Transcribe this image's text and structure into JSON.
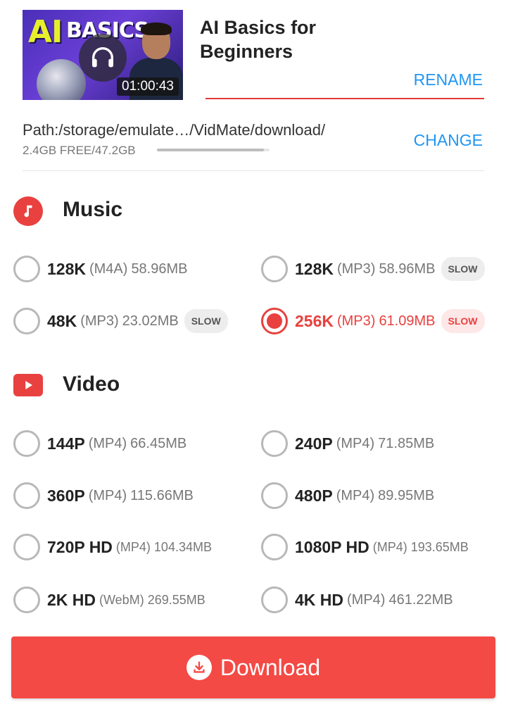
{
  "header": {
    "title": "AI Basics for Beginners",
    "thumbnail": {
      "text_ai": "AI",
      "text_basics": "BASICS",
      "duration": "01:00:43"
    },
    "rename_label": "RENAME"
  },
  "storage": {
    "path": "Path:/storage/emulate…/VidMate/download/",
    "free": "2.4GB FREE/47.2GB",
    "used_fraction": 0.95,
    "change_label": "CHANGE"
  },
  "music": {
    "title": "Music",
    "options": [
      {
        "quality": "128K",
        "format": "(M4A)",
        "size": "58.96MB",
        "slow": ""
      },
      {
        "quality": "128K",
        "format": "(MP3)",
        "size": "58.96MB",
        "slow": "SLOW"
      },
      {
        "quality": "48K",
        "format": "(MP3)",
        "size": "23.02MB",
        "slow": "SLOW"
      },
      {
        "quality": "256K",
        "format": "(MP3)",
        "size": "61.09MB",
        "slow": "SLOW",
        "selected": true
      }
    ]
  },
  "video": {
    "title": "Video",
    "options": [
      {
        "quality": "144P",
        "format": "(MP4)",
        "size": "66.45MB"
      },
      {
        "quality": "240P",
        "format": "(MP4)",
        "size": "71.85MB"
      },
      {
        "quality": "360P",
        "format": "(MP4)",
        "size": "115.66MB"
      },
      {
        "quality": "480P",
        "format": "(MP4)",
        "size": "89.95MB"
      },
      {
        "quality": "720P HD",
        "format": "(MP4)",
        "size": "104.34MB"
      },
      {
        "quality": "1080P HD",
        "format": "(MP4)",
        "size": "193.65MB"
      },
      {
        "quality": "2K HD",
        "format": "(WebM)",
        "size": "269.55MB"
      },
      {
        "quality": "4K HD",
        "format": "(MP4)",
        "size": "461.22MB"
      }
    ]
  },
  "download_label": "Download",
  "colors": {
    "accent": "#e8413f",
    "link": "#2196f3",
    "button": "#f44a45"
  }
}
